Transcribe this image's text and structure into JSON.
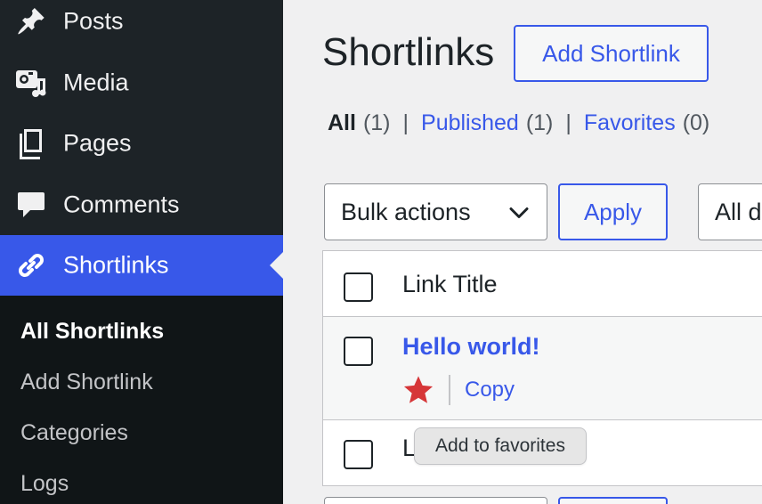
{
  "sidebar": {
    "items": [
      {
        "label": "Posts",
        "icon": "pin-icon"
      },
      {
        "label": "Media",
        "icon": "media-icon"
      },
      {
        "label": "Pages",
        "icon": "pages-icon"
      },
      {
        "label": "Comments",
        "icon": "comment-icon"
      },
      {
        "label": "Shortlinks",
        "icon": "link-icon",
        "active": true
      }
    ],
    "submenu": [
      {
        "label": "All Shortlinks",
        "current": true
      },
      {
        "label": "Add Shortlink"
      },
      {
        "label": "Categories"
      },
      {
        "label": "Logs"
      }
    ]
  },
  "main": {
    "title": "Shortlinks",
    "add_button": "Add Shortlink",
    "filters": {
      "all": "All",
      "all_count": "(1)",
      "published": "Published",
      "published_count": "(1)",
      "favorites": "Favorites",
      "favorites_count": "(0)",
      "separator": "|"
    },
    "bulk_actions": "Bulk actions",
    "apply": "Apply",
    "date_filter": "All d",
    "table": {
      "header": "Link Title",
      "rows": [
        {
          "title": "Hello world!",
          "copy": "Copy",
          "favorite_icon": "star-icon"
        },
        {
          "title": "L"
        }
      ]
    },
    "tooltip": "Add to favorites"
  },
  "colors": {
    "accent": "#3858e9",
    "sidebar_bg": "#1d2327",
    "submenu_bg": "#101517",
    "star": "#d63638"
  }
}
